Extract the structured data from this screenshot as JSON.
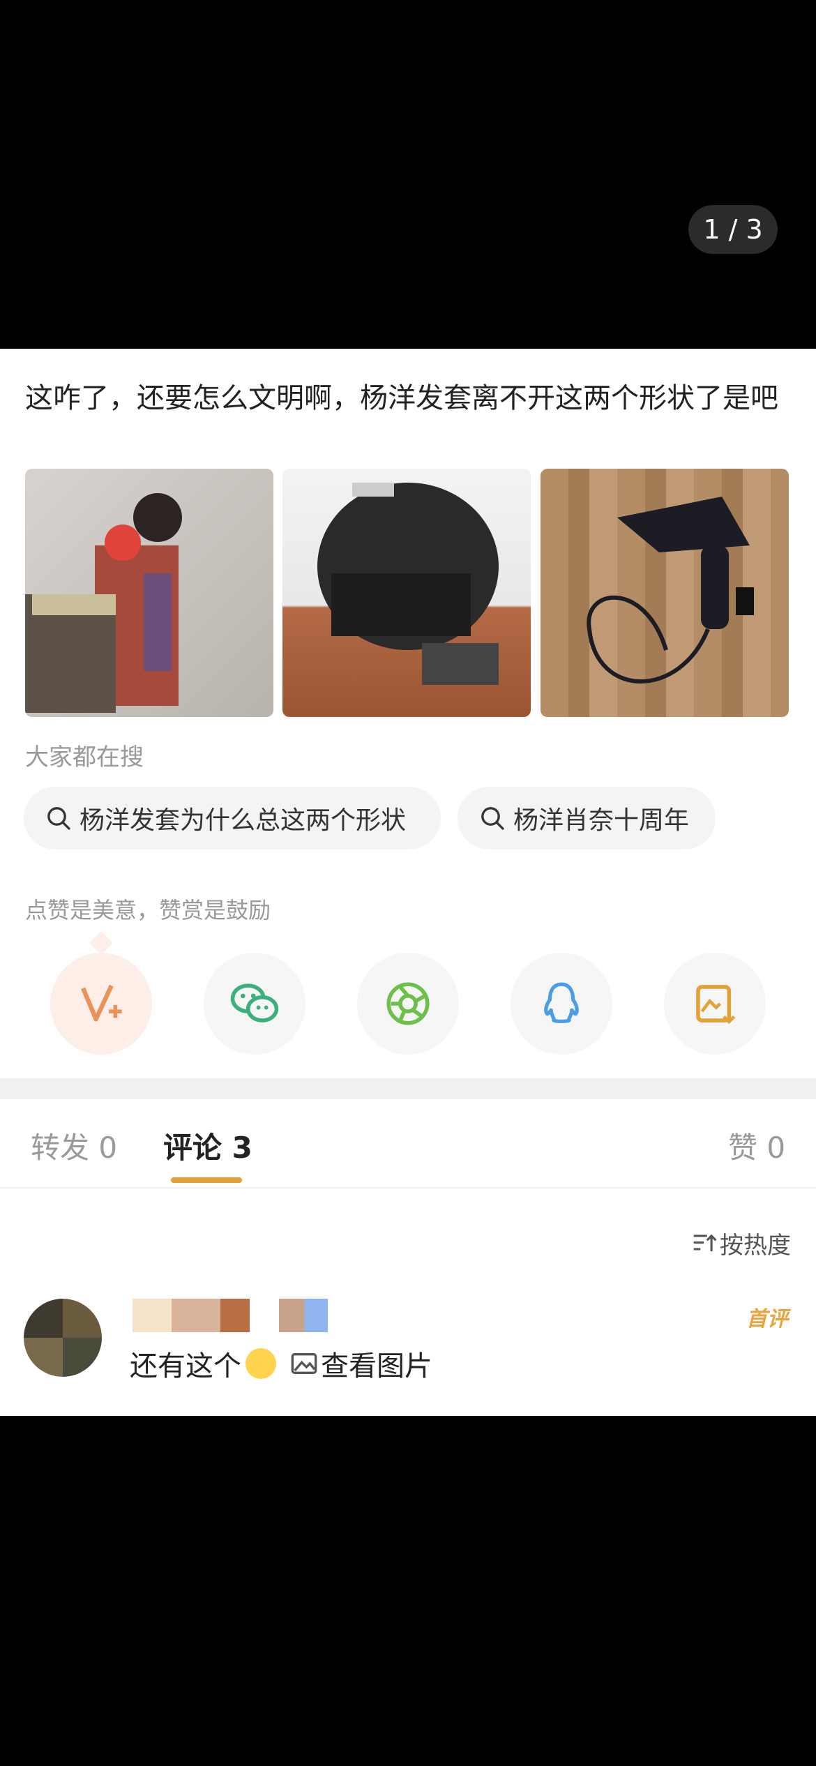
{
  "viewer": {
    "counter": "1 / 3"
  },
  "post": {
    "text": "这咋了，还要怎么文明啊，杨洋发套离不开这两个形状了是吧"
  },
  "search": {
    "title": "大家都在搜",
    "chips": [
      "杨洋发套为什么总这两个形状",
      "杨洋肖奈十周年"
    ]
  },
  "reward": {
    "text": "点赞是美意，赞赏是鼓励"
  },
  "share_icons": [
    "v-plus-icon",
    "wechat-icon",
    "moments-icon",
    "qq-icon",
    "save-image-icon"
  ],
  "tabs": {
    "repost": "转发 0",
    "comments": "评论 3",
    "likes": "赞 0"
  },
  "sort": {
    "label": "按热度"
  },
  "comment": {
    "badge": "首评",
    "text": "还有这个",
    "link": "查看图片"
  },
  "colors": {
    "accent": "#e1a23a",
    "wechat": "#3bb07c",
    "qq": "#4a9ee8",
    "vplus": "#e8935a"
  }
}
